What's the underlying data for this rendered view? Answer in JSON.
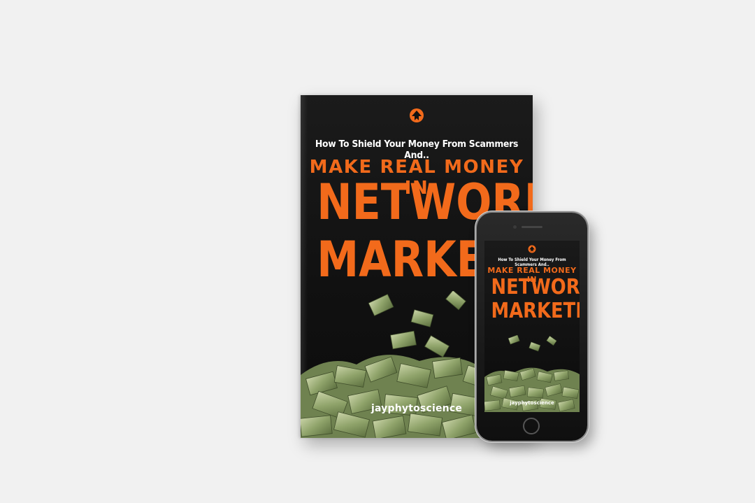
{
  "book": {
    "tagline": "How To Shield Your Money From Scammers And..",
    "title_line1": "MAKE REAL MONEY IN",
    "title_line2": "NETWORK",
    "title_line3": "MARKETING",
    "author": "jayphytoscience",
    "logo": "upward-arrow-logo-icon"
  },
  "phone": {
    "screen": {
      "tagline": "How To Shield Your Money From Scammers And..",
      "title_line1": "MAKE REAL MONEY IN",
      "title_line2": "NETWORK",
      "title_line3": "MARKETING",
      "author": "jayphytoscience"
    }
  },
  "colors": {
    "background": "#f1f1f1",
    "cover": "#111111",
    "accent": "#f26a1b",
    "money": "#9fb27a"
  }
}
